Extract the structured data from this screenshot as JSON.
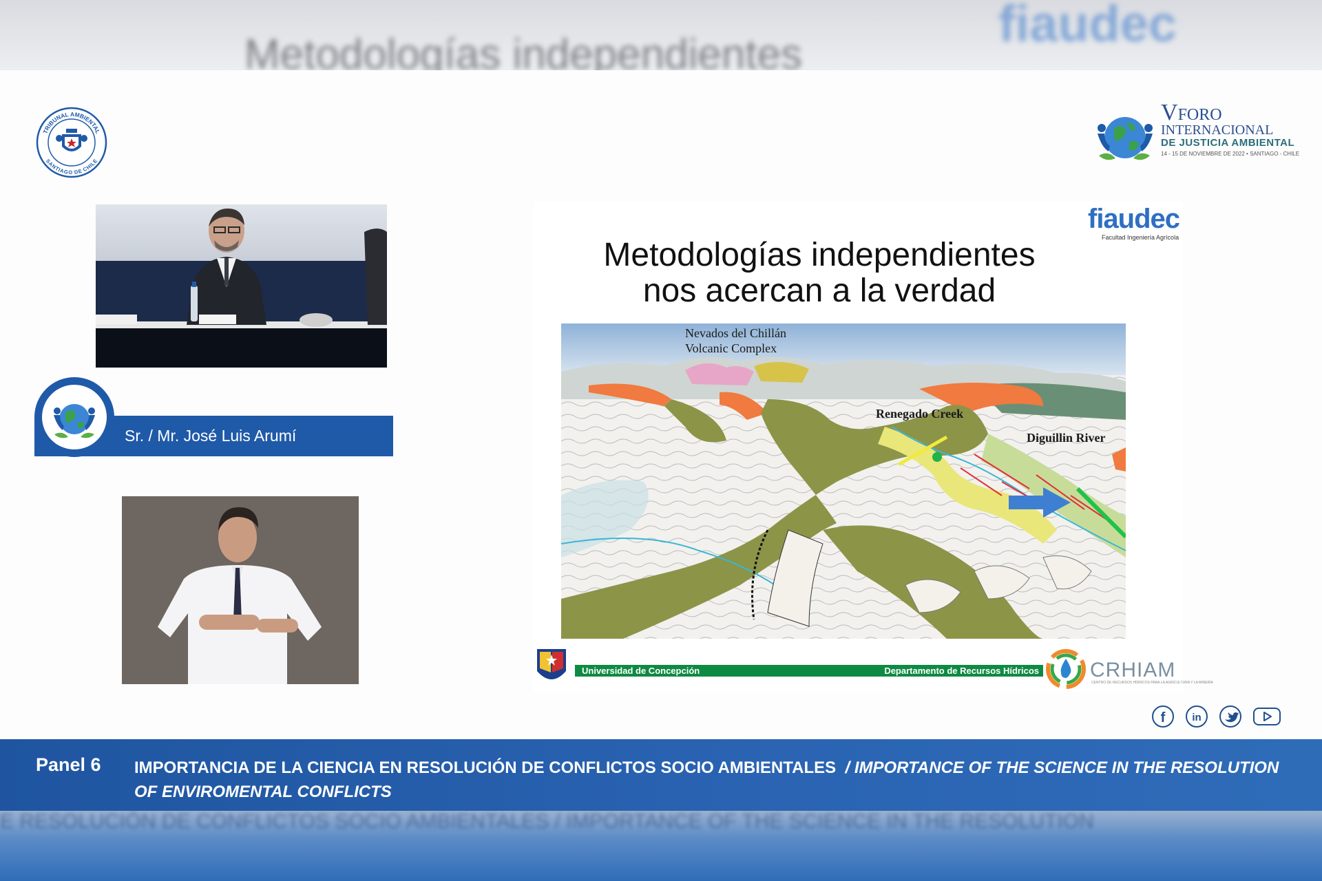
{
  "background": {
    "top_ghost_text": "Metodologías  independientes",
    "top_ghost_logo": "fiaudec",
    "bottom_ghost_text": "E RESOLUCIÓN DE CONFLICTOS SOCIO AMBIENTALES  / IMPORTANCE OF THE SCIENCE IN THE RESOLUTION"
  },
  "header": {
    "tribunal_logo": {
      "icon": "tribunal-ambiental-seal-icon",
      "ring_top": "TRIBUNAL AMBIENTAL",
      "ring_bottom": "SANTIAGO DE CHILE"
    },
    "forum_logo": {
      "icon": "globe-people-icon",
      "numeral": "V",
      "line1": "FORO",
      "line2": "INTERNACIONAL",
      "line3": "DE JUSTICIA AMBIENTAL",
      "line4": "14 - 15 DE NOVIEMBRE DE 2022 • SANTIAGO - CHILE"
    }
  },
  "speaker": {
    "name_label": "Sr. / Mr. José Luis Arumí",
    "badge_icon": "globe-people-icon"
  },
  "slide": {
    "title_line1": "Metodologías  independientes",
    "title_line2": "nos acercan a la verdad",
    "fiaudec_logo": "fiaudec",
    "fiaudec_sub": "Facultad Ingeniería Agrícola",
    "map_labels": {
      "complex_line1": "Nevados del Chillán",
      "complex_line2": "Volcanic Complex",
      "creek": "Renegado Creek",
      "river": "Diguillin River"
    },
    "footer_left": "Universidad de Concepción",
    "footer_right": "Departamento de Recursos Hídricos",
    "crhiam_logo": "CRHIAM",
    "crhiam_sub": "CENTRO DE RECURSOS HÍDRICOS PARA LA AGRICULTURA Y LA MINERÍA"
  },
  "social": [
    {
      "icon": "facebook-icon",
      "glyph": "f"
    },
    {
      "icon": "linkedin-icon",
      "glyph": "in"
    },
    {
      "icon": "twitter-icon",
      "glyph": ""
    },
    {
      "icon": "youtube-icon",
      "glyph": ""
    }
  ],
  "banner": {
    "panel_label": "Panel 6",
    "topic_es": "IMPORTANCIA DE LA CIENCIA EN RESOLUCIÓN DE CONFLICTOS SOCIO AMBIENTALES",
    "topic_en": "/ IMPORTANCE OF THE SCIENCE IN THE RESOLUTION OF ENVIROMENTAL  CONFLICTS"
  },
  "colors": {
    "brand_blue": "#1f5aa8",
    "udec_green": "#0f8a43",
    "fiaudec_blue": "#2e6fc3"
  }
}
